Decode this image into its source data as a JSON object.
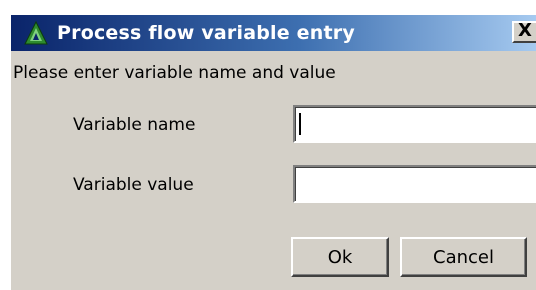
{
  "window": {
    "title": "Process flow variable entry",
    "close_glyph": "X",
    "title_gradient": [
      "#0a246a",
      "#a6caf0"
    ],
    "icon": "green-triangle-app-icon"
  },
  "dialog": {
    "prompt": "Please enter variable name and value",
    "variable_name_label": "Variable name",
    "variable_value_label": "Variable value",
    "variable_name_value": "",
    "variable_value_value": "",
    "ok_label": "Ok",
    "cancel_label": "Cancel"
  },
  "colors": {
    "face": "#d4d0c8",
    "title_text": "#ffffff"
  }
}
